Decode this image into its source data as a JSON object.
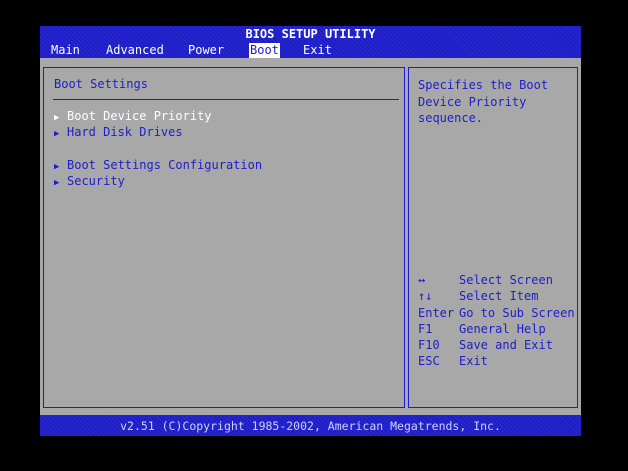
{
  "header": {
    "title": "BIOS SETUP UTILITY",
    "menu": [
      {
        "label": "Main"
      },
      {
        "label": "Advanced"
      },
      {
        "label": "Power"
      },
      {
        "label": "Boot",
        "active": true
      },
      {
        "label": "Exit"
      }
    ]
  },
  "main": {
    "section_title": "Boot Settings",
    "options": [
      {
        "label": "Boot Device Priority",
        "selected": true
      },
      {
        "label": "Hard Disk Drives"
      },
      {
        "label": "Boot Settings Configuration"
      },
      {
        "label": "Security"
      }
    ],
    "arrow_glyph": "▶"
  },
  "help": {
    "text": "Specifies the Boot\nDevice Priority\nsequence.",
    "keys": [
      {
        "key": "↔",
        "desc": "Select Screen"
      },
      {
        "key": "↑↓",
        "desc": "Select Item"
      },
      {
        "key": "Enter",
        "desc": "Go to Sub Screen"
      },
      {
        "key": "F1",
        "desc": "General Help"
      },
      {
        "key": "F10",
        "desc": "Save and Exit"
      },
      {
        "key": "ESC",
        "desc": "Exit"
      }
    ]
  },
  "footer": {
    "copyright": "v2.51 (C)Copyright 1985-2002, American Megatrends, Inc."
  },
  "colors": {
    "bios_blue": "#1e1ec8",
    "panel_gray": "#a8a8a8",
    "highlight": "#ffffff"
  }
}
